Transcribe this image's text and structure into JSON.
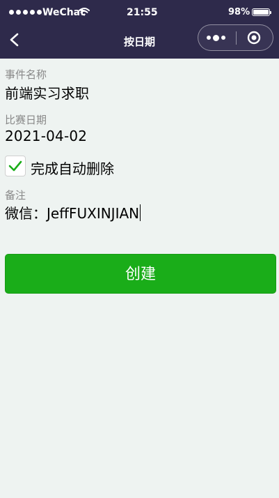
{
  "status_bar": {
    "carrier": "WeChat",
    "time": "21:55",
    "battery": "98%"
  },
  "nav": {
    "title": "按日期"
  },
  "form": {
    "event_name_label": "事件名称",
    "event_name_value": "前端实习求职",
    "date_label": "比赛日期",
    "date_value": "2021-04-02",
    "auto_delete_label": "完成自动删除",
    "auto_delete_checked": true,
    "note_label": "备注",
    "note_value": "微信：JeffFUXINJIAN"
  },
  "actions": {
    "create_label": "创建"
  },
  "colors": {
    "nav_bg": "#2e2a4b",
    "page_bg": "#eef3f1",
    "primary": "#1aad19",
    "label_gray": "#888888"
  }
}
